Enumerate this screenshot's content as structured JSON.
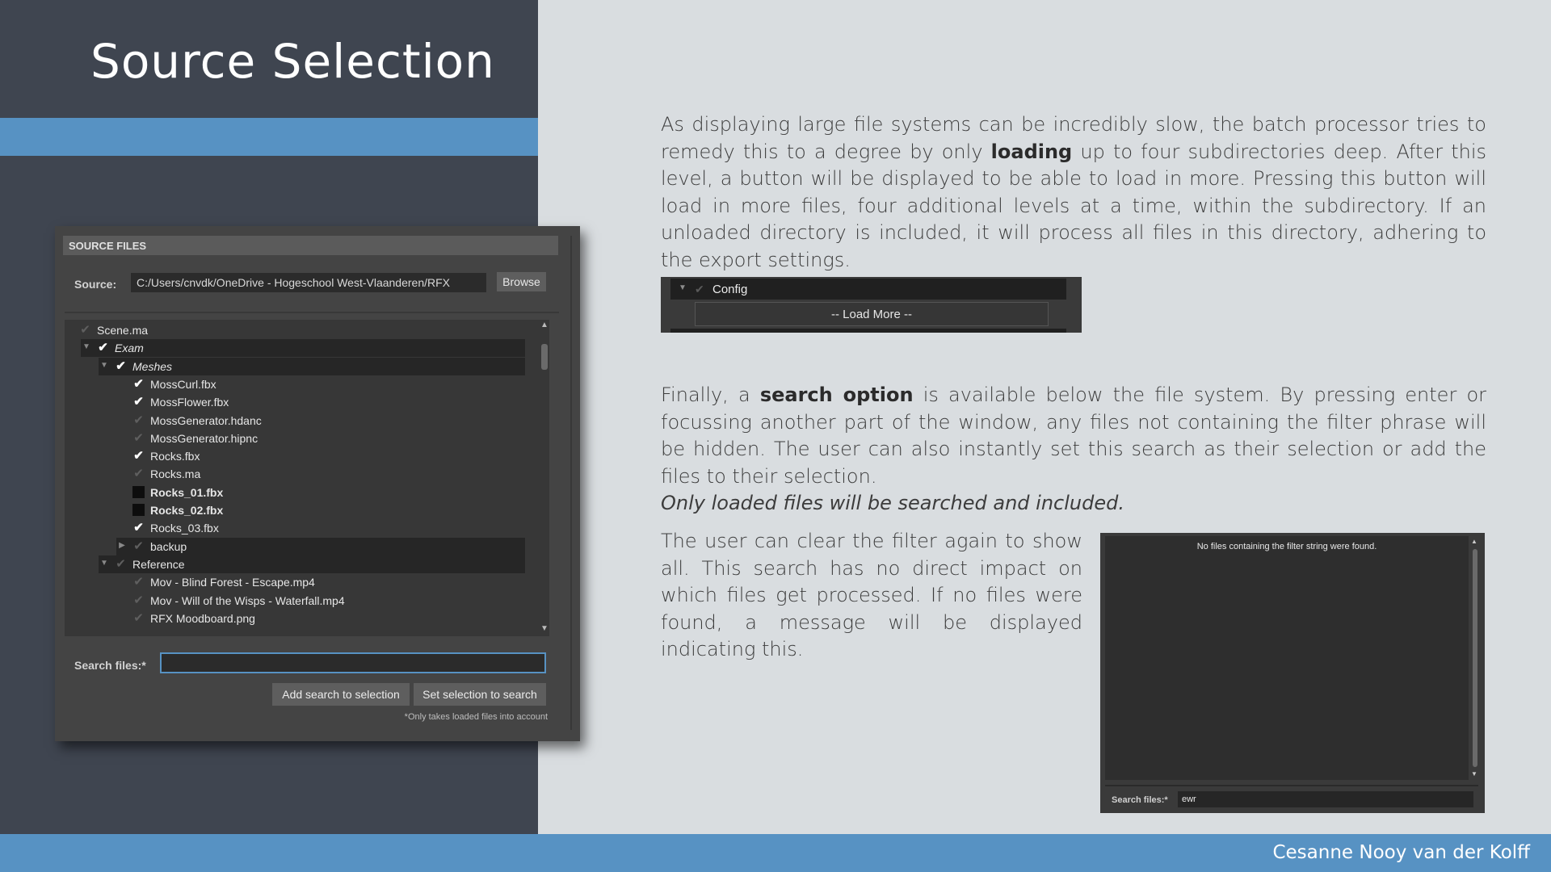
{
  "slide": {
    "title": "Source Selection",
    "author": "Cesanne Nooy van der Kolff"
  },
  "colors": {
    "dark_panel": "#3f4550",
    "accent_blue": "#5792c3",
    "background": "#d9dde0"
  },
  "source_panel": {
    "header": "SOURCE FILES",
    "source_label": "Source:",
    "source_path": "C:/Users/cnvdk/OneDrive - Hogeschool West-Vlaanderen/RFX",
    "browse_label": "Browse",
    "tree": [
      {
        "label": "Scene.ma",
        "depth": 0,
        "arrow": "",
        "check": "partial",
        "style": "normal",
        "selected": false
      },
      {
        "label": "Exam",
        "depth": 1,
        "arrow": "down",
        "check": "checked",
        "style": "italic",
        "selected": true
      },
      {
        "label": "Meshes",
        "depth": 2,
        "arrow": "down",
        "check": "checked",
        "style": "italic",
        "selected": true
      },
      {
        "label": "MossCurl.fbx",
        "depth": 3,
        "arrow": "",
        "check": "checked",
        "style": "normal",
        "selected": false
      },
      {
        "label": "MossFlower.fbx",
        "depth": 3,
        "arrow": "",
        "check": "checked",
        "style": "normal",
        "selected": false
      },
      {
        "label": "MossGenerator.hdanc",
        "depth": 3,
        "arrow": "",
        "check": "partial",
        "style": "normal",
        "selected": false
      },
      {
        "label": "MossGenerator.hipnc",
        "depth": 3,
        "arrow": "",
        "check": "partial",
        "style": "normal",
        "selected": false
      },
      {
        "label": "Rocks.fbx",
        "depth": 3,
        "arrow": "",
        "check": "checked",
        "style": "normal",
        "selected": false
      },
      {
        "label": "Rocks.ma",
        "depth": 3,
        "arrow": "",
        "check": "partial",
        "style": "normal",
        "selected": false
      },
      {
        "label": "Rocks_01.fbx",
        "depth": 3,
        "arrow": "",
        "check": "unchecked",
        "style": "bold",
        "selected": false
      },
      {
        "label": "Rocks_02.fbx",
        "depth": 3,
        "arrow": "",
        "check": "unchecked",
        "style": "bold",
        "selected": false
      },
      {
        "label": "Rocks_03.fbx",
        "depth": 3,
        "arrow": "",
        "check": "checked",
        "style": "normal",
        "selected": false
      },
      {
        "label": "backup",
        "depth": 3,
        "arrow": "right",
        "check": "partial",
        "style": "normal",
        "selected": true
      },
      {
        "label": "Reference",
        "depth": 2,
        "arrow": "down",
        "check": "partial",
        "style": "normal",
        "selected": true
      },
      {
        "label": "Mov - Blind Forest - Escape.mp4",
        "depth": 3,
        "arrow": "",
        "check": "partial",
        "style": "normal",
        "selected": false
      },
      {
        "label": "Mov - Will of the Wisps -  Waterfall.mp4",
        "depth": 3,
        "arrow": "",
        "check": "partial",
        "style": "normal",
        "selected": false
      },
      {
        "label": "RFX Moodboard.png",
        "depth": 3,
        "arrow": "",
        "check": "partial",
        "style": "normal",
        "selected": false
      }
    ],
    "search_label": "Search files:*",
    "search_value": "",
    "add_search_label": "Add search to selection",
    "set_selection_label": "Set selection to search",
    "note": "*Only takes loaded files into account"
  },
  "text": {
    "p1_a": "As displaying large file systems can be incredibly slow, the batch processor tries to remedy this to a degree by only ",
    "p1_bold": "loading",
    "p1_b": " up to four subdirectories deep. After this level, a button will be displayed to be able to load in more. Pressing this button will load in more files, four additional levels at a time, within the subdirectory. If an unloaded directory is included, it will process all files in this directory, adhering to the export settings.",
    "p2_a": "Finally, a ",
    "p2_bold": "search option",
    "p2_b": " is available below the file system. By pressing enter or focussing another part of the window, any files not containing the filter phrase will be hidden. The user can also instantly set this search as their selection or add the files to their selection.",
    "p2_italic": "Only loaded files will be searched and included.",
    "p3": "The user can clear the filter again to show all. This search has no direct impact on which files get processed. If no files were found, a message will be displayed indicating this."
  },
  "config_example": {
    "folder": "Config",
    "load_more": "-- Load More --"
  },
  "empty_example": {
    "message": "No files containing the filter string were found.",
    "search_label": "Search files:*",
    "search_value": "ewr"
  }
}
